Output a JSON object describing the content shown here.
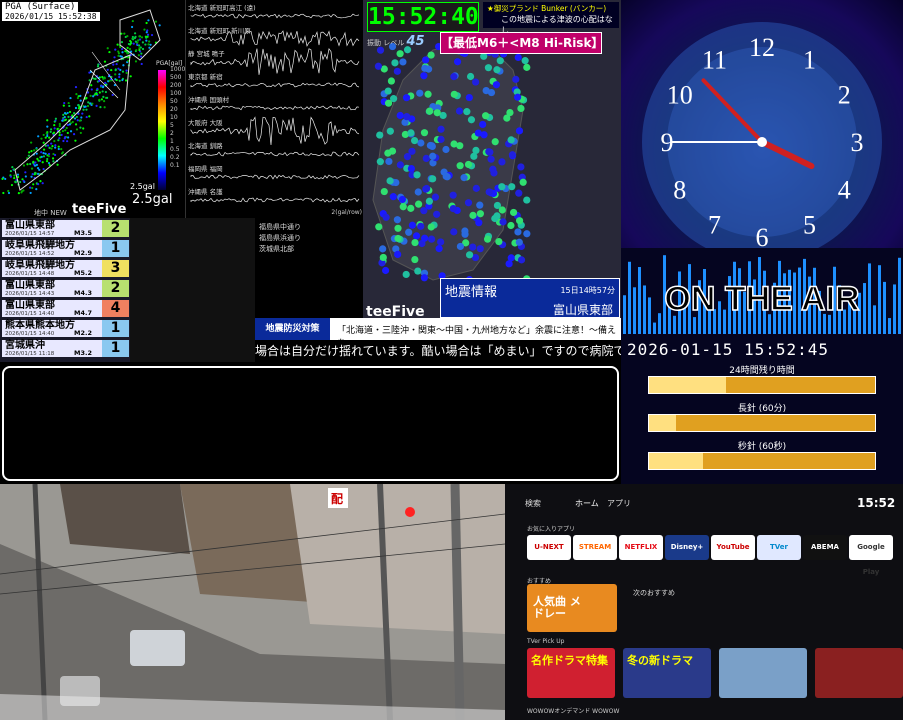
{
  "pga_panel": {
    "title": "PGA (Surface)",
    "timestamp": "2026/01/15 15:52:38",
    "scale_title": "PGA[gal]",
    "scale_labels": [
      "1000",
      "500",
      "200",
      "100",
      "50",
      "20",
      "10",
      "5",
      "2",
      "1",
      "0.5",
      "0.2",
      "0.1"
    ],
    "gal_small": "2.5gal",
    "gal_big": "2.5gal",
    "brand": "teeFive",
    "sub_brand": "地中 NEW",
    "map_labels": [
      "福島県",
      "福島県",
      "奈良 0.1gal",
      "栃木",
      "宮城県"
    ]
  },
  "seismograph": {
    "stations": [
      "北海道 新冠町高江 (遠)",
      "北海道 新冠町 新川原",
      "静 宮城 鳴子",
      "東京都 新宿",
      "沖縄県 国頭村",
      "大阪府 大阪",
      "北海道 釧路",
      "福岡県 福岡",
      "沖縄県 名護"
    ],
    "unit": "2(gal/row)"
  },
  "eq_list": [
    {
      "region": "富山県東部",
      "time": "2026/01/15 14:57",
      "mag": "M3.5",
      "intensity": "2",
      "color": "#b8e070"
    },
    {
      "region": "岐阜県飛騨地方",
      "time": "2026/01/15 14:52",
      "mag": "M2.9",
      "intensity": "1",
      "color": "#8ac8f0"
    },
    {
      "region": "岐阜県飛騨地方",
      "time": "2026/01/15 14:48",
      "mag": "M5.2",
      "intensity": "3",
      "color": "#f0e060"
    },
    {
      "region": "富山県東部",
      "time": "2026/01/15 14:43",
      "mag": "M4.3",
      "intensity": "2",
      "color": "#b8e070"
    },
    {
      "region": "富山県東部",
      "time": "2026/01/15 14:40",
      "mag": "M4.7",
      "intensity": "4",
      "color": "#f08060"
    },
    {
      "region": "熊本県熊本地方",
      "time": "2026/01/15 14:40",
      "mag": "M2.2",
      "intensity": "1",
      "color": "#8ac8f0"
    },
    {
      "region": "宮城県沖",
      "time": "2026/01/15 11:18",
      "mag": "M3.2",
      "intensity": "1",
      "color": "#8ac8f0"
    }
  ],
  "regions_list": [
    "福島県中通り",
    "福島県浜通り",
    "茨城県北部"
  ],
  "intensity_map": {
    "clock": "15:52:40",
    "bunker_title": "★御災プランド Bunker (バンカー)",
    "bunker_sub": "この地震による津波の心配はなし",
    "risk_label": "【最低M6＋<M8 Hi-Risk】",
    "level_label": "振動 レベル",
    "level_value": "45",
    "eq_info_title": "地震情報",
    "eq_info_time": "15日14時57分",
    "eq_info_region": "富山県東部",
    "brand": "teeFive"
  },
  "ticker": {
    "label": "地震防災対策",
    "headline": "「北海道・三陸沖・関東～中国・九州地方など」余震に注意！～備えを～",
    "scroll": "場合は自分だけ揺れています。酷い場合は「めまい」ですので病院で受診"
  },
  "analog_clock": {
    "numerals": [
      "12",
      "1",
      "2",
      "3",
      "4",
      "5",
      "6",
      "7",
      "8",
      "9",
      "10",
      "11"
    ],
    "hour": 3,
    "minute": 52,
    "second": 45
  },
  "on_air": {
    "title": "ON THE AIR",
    "datetime": "2026-01-15 15:52:45",
    "bars": [
      {
        "label": "24時間残り時間",
        "fraction": 0.34
      },
      {
        "label": "長針 (60分)",
        "fraction": 0.12
      },
      {
        "label": "秒針 (60秒)",
        "fraction": 0.24
      }
    ]
  },
  "tv": {
    "nav": [
      "検索",
      "ホーム",
      "アプリ"
    ],
    "time": "15:52",
    "favorites_title": "お気に入りアプリ",
    "apps": [
      "U-NEXT",
      "STREAM",
      "NETFLIX",
      "Disney+",
      "YouTube",
      "TVer",
      "ABEMA",
      "Google Play"
    ],
    "section_recommend": "おすすめ",
    "recommend_tile": "人気曲 メドレー",
    "recommend_note": "次のおすすめ",
    "section_tver": "TVer Pick Up",
    "tver_tiles": [
      "名作ドラマ特集",
      "冬の新ドラマ",
      "",
      ""
    ],
    "footer": "WOWOWオンデマンド WOWOW"
  },
  "camera": {
    "sign": "配",
    "brand": ""
  }
}
